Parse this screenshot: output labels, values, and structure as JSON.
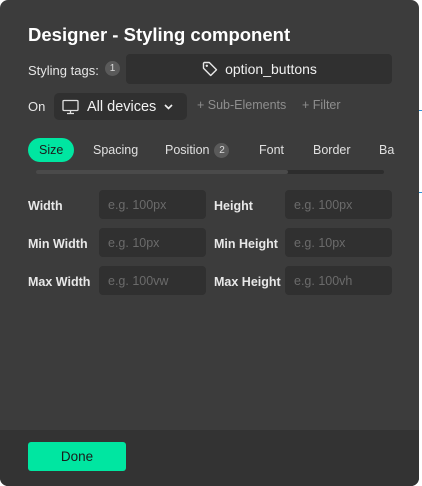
{
  "dialog": {
    "title": "Designer - Styling component"
  },
  "styling_tags": {
    "label": "Styling tags:",
    "count": "1",
    "tag": "option_buttons",
    "tag_icon": "tag-icon"
  },
  "on_row": {
    "label": "On",
    "device": "All devices",
    "device_icon": "monitor-icon",
    "sub_elements": "+ Sub-Elements",
    "filter": "+ Filter"
  },
  "tabs": [
    {
      "label": "Size",
      "active": true
    },
    {
      "label": "Spacing"
    },
    {
      "label": "Position",
      "count": "2"
    },
    {
      "label": "Font"
    },
    {
      "label": "Border"
    },
    {
      "label": "Ba"
    }
  ],
  "fields": {
    "width": {
      "label": "Width",
      "placeholder": "e.g. 100px"
    },
    "height": {
      "label": "Height",
      "placeholder": "e.g. 100px"
    },
    "min_width": {
      "label": "Min Width",
      "placeholder": "e.g. 10px"
    },
    "min_height": {
      "label": "Min Height",
      "placeholder": "e.g. 10px"
    },
    "max_width": {
      "label": "Max Width",
      "placeholder": "e.g. 100vw"
    },
    "max_height": {
      "label": "Max Height",
      "placeholder": "e.g. 100vh"
    }
  },
  "footer": {
    "done_label": "Done"
  },
  "colors": {
    "panel": "#3c3c3c",
    "accent": "#00e6a1",
    "field": "#303030"
  }
}
